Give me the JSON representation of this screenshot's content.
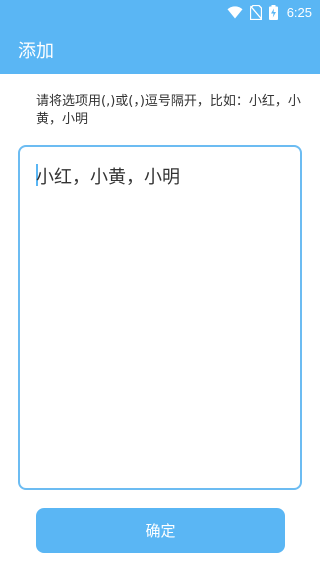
{
  "status_bar": {
    "time": "6:25",
    "icons": [
      "wifi-icon",
      "no-sim-icon",
      "battery-charging-icon"
    ]
  },
  "app_bar": {
    "title": "添加"
  },
  "form": {
    "hint": "请将选项用(,)或(，)逗号隔开，比如：小红，小黄，小明",
    "options_value": "小红，小黄，小明"
  },
  "confirm_button": {
    "label": "确定"
  },
  "colors": {
    "primary": "#5ab6f4",
    "input_border": "#6cbcf2",
    "text": "#333333"
  }
}
